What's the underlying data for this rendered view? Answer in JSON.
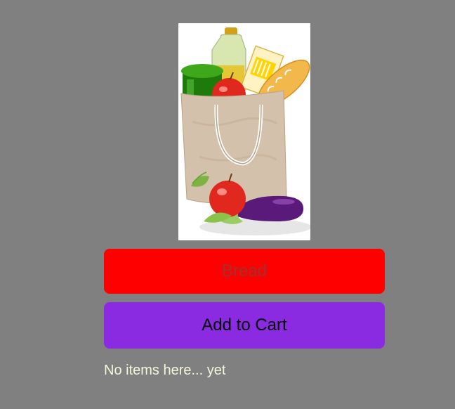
{
  "item_input": {
    "placeholder": "Bread",
    "value": ""
  },
  "add_button": {
    "label": "Add to Cart"
  },
  "cart": {
    "empty_message": "No items here... yet"
  },
  "colors": {
    "background": "#808080",
    "input_background": "#ff0000",
    "placeholder_text": "#9c3333",
    "button_background": "#8a2be2",
    "button_text": "#000000",
    "message_text": "#f5f5dc"
  },
  "image": {
    "subject": "grocery-bag-icon"
  }
}
